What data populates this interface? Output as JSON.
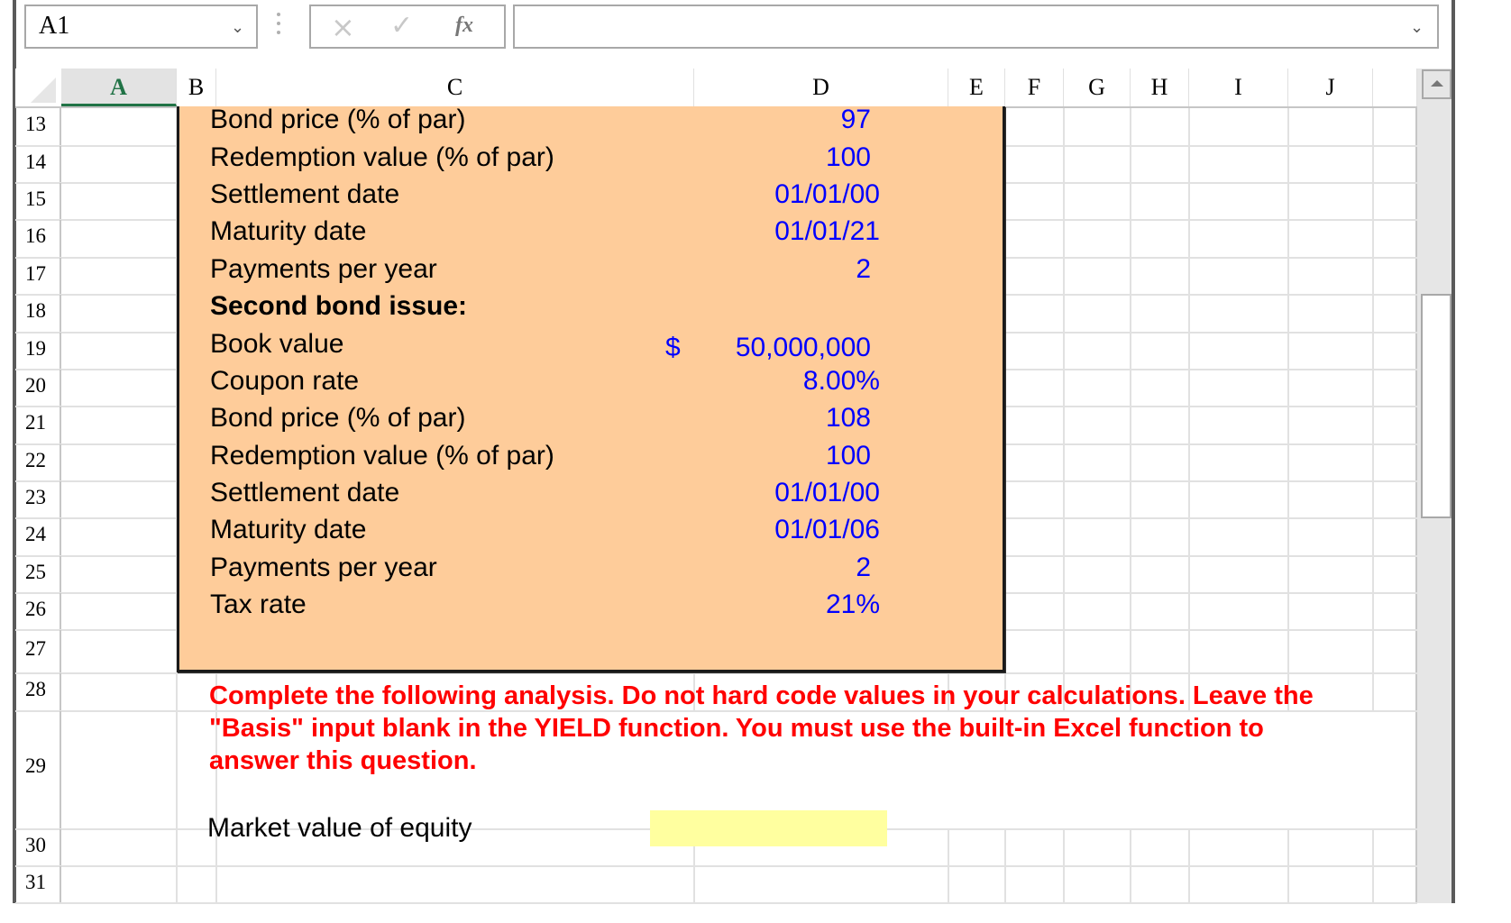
{
  "formula_bar": {
    "name_box_value": "A1",
    "name_box_chevron": "⌄",
    "cancel_icon": "×",
    "enter_icon": "✓",
    "fx_icon": "fx",
    "formula_value": "",
    "formula_chevron": "⌄"
  },
  "columns": [
    "A",
    "B",
    "C",
    "D",
    "E",
    "F",
    "G",
    "H",
    "I",
    "J",
    ""
  ],
  "active_column": "A",
  "rows": [
    "13",
    "14",
    "15",
    "16",
    "17",
    "18",
    "19",
    "20",
    "21",
    "22",
    "23",
    "24",
    "25",
    "26",
    "27",
    "28",
    "29",
    "30",
    "31"
  ],
  "input_box": {
    "items": [
      {
        "row": "13",
        "label": "Bond price (% of par)",
        "value": "97",
        "bold": false
      },
      {
        "row": "14",
        "label": "Redemption value (% of par)",
        "value": "100",
        "bold": false
      },
      {
        "row": "15",
        "label": "Settlement date",
        "value": "01/01/00",
        "bold": false
      },
      {
        "row": "16",
        "label": "Maturity date",
        "value": "01/01/21",
        "bold": false
      },
      {
        "row": "17",
        "label": "Payments per year",
        "value": "2",
        "bold": false
      },
      {
        "row": "18",
        "label": "Second bond issue:",
        "value": "",
        "bold": true
      },
      {
        "row": "19",
        "label": "Book value",
        "value": "50,000,000",
        "currency": "$",
        "bold": false
      },
      {
        "row": "20",
        "label": "Coupon rate",
        "value": "8.00%",
        "bold": false
      },
      {
        "row": "21",
        "label": "Bond price (% of par)",
        "value": "108",
        "bold": false
      },
      {
        "row": "22",
        "label": "Redemption value (% of par)",
        "value": "100",
        "bold": false
      },
      {
        "row": "23",
        "label": "Settlement date",
        "value": "01/01/00",
        "bold": false
      },
      {
        "row": "24",
        "label": "Maturity date",
        "value": "01/01/06",
        "bold": false
      },
      {
        "row": "25",
        "label": "Payments per year",
        "value": "2",
        "bold": false
      },
      {
        "row": "26",
        "label": "Tax rate",
        "value": "21%",
        "bold": false
      }
    ],
    "fill_color": "#fecc9a",
    "value_color": "#0000ff"
  },
  "instructions": "Complete the following analysis. Do not hard code values in your calculations. Leave the \"Basis\" input blank in the YIELD function. You must use the built-in Excel function to answer this question.",
  "instructions_color": "#ff0000",
  "analysis": {
    "market_value_label": "Market value of equity",
    "market_value": "",
    "input_fill": "#ffff9f"
  }
}
